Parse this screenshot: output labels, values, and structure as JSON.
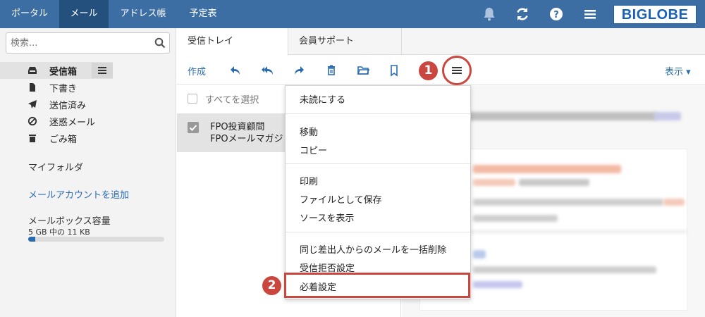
{
  "nav": {
    "tabs": [
      {
        "label": "ポータル"
      },
      {
        "label": "メール"
      },
      {
        "label": "アドレス帳"
      },
      {
        "label": "予定表"
      }
    ],
    "logo_text": "BIGLOBE"
  },
  "sidebar": {
    "search_placeholder": "検索...",
    "folders": [
      {
        "label": "受信箱",
        "icon": "inbox-icon"
      },
      {
        "label": "下書き",
        "icon": "file-icon"
      },
      {
        "label": "送信済み",
        "icon": "send-icon"
      },
      {
        "label": "迷惑メール",
        "icon": "block-icon"
      },
      {
        "label": "ごみ箱",
        "icon": "trash-icon"
      }
    ],
    "my_folder": "マイフォルダ",
    "add_account": "メールアカウントを追加",
    "capacity_title": "メールボックス容量",
    "capacity_text": "5 GB 中の 11 KB",
    "capacity_fraction": 0.05
  },
  "tabs": {
    "inbox": "受信トレイ",
    "support": "会員サポート"
  },
  "toolbar": {
    "compose": "作成",
    "view": "表示 ▾"
  },
  "list": {
    "select_all": "すべてを選択",
    "mail": {
      "sender": "FPO投資顧問",
      "subject": "FPOメールマガジ"
    }
  },
  "menu": {
    "items": [
      "未読にする",
      "移動",
      "コピー",
      "印刷",
      "ファイルとして保存",
      "ソースを表示",
      "同じ差出人からのメールを一括削除",
      "受信拒否設定",
      "必着設定"
    ]
  },
  "annotations": {
    "step1": "1",
    "step2": "2"
  },
  "colors": {
    "nav_bg": "#3c6ea4",
    "accent": "#2a6bb0",
    "highlight": "#c9473f"
  }
}
